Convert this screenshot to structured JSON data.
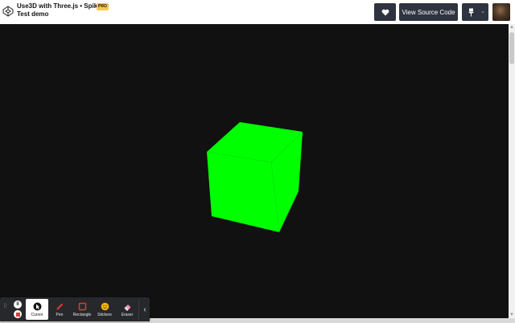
{
  "header": {
    "title_line1": "Use3D with Three.js • Spiking",
    "title_line2": "Test demo",
    "pro_badge": "PRO",
    "logo_icon": "codepen-logo-icon"
  },
  "actions": {
    "heart_icon": "heart-icon",
    "view_source_label": "View Source Code",
    "pin_icon": "pin-icon",
    "chevron": "⌄"
  },
  "scene": {
    "background": "#111111",
    "cube_color": "#00ff00"
  },
  "toolbar": {
    "tools": [
      {
        "label": "Cursor",
        "icon": "cursor-icon"
      },
      {
        "label": "Pen",
        "icon": "pen-icon"
      },
      {
        "label": "Rectangle",
        "icon": "rectangle-icon"
      },
      {
        "label": "Stickers",
        "icon": "stickers-icon"
      },
      {
        "label": "Eraser",
        "icon": "eraser-icon"
      }
    ],
    "collapse_glyph": "‹"
  }
}
